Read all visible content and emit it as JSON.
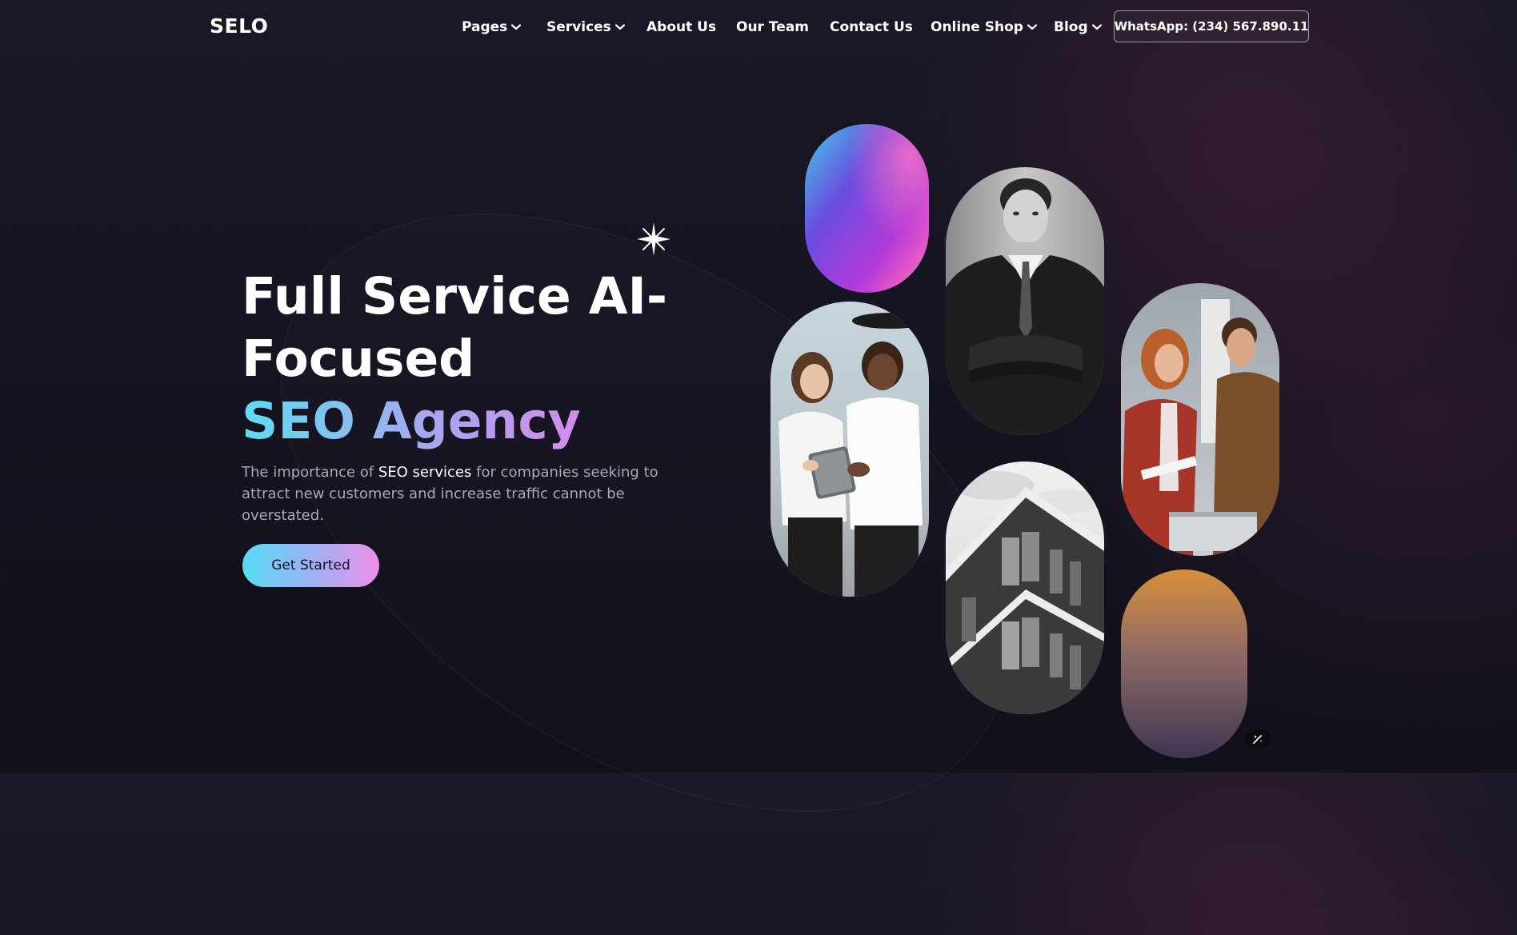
{
  "nav": {
    "logo": "SELO",
    "items": [
      {
        "label": "Pages",
        "dropdown": true
      },
      {
        "label": "Services",
        "dropdown": true
      },
      {
        "label": "About Us",
        "dropdown": false
      },
      {
        "label": "Our Team",
        "dropdown": false
      },
      {
        "label": "Contact Us",
        "dropdown": false
      },
      {
        "label": "Online Shop",
        "dropdown": true
      },
      {
        "label": "Blog",
        "dropdown": true
      }
    ],
    "whatsapp_label": "WhatsApp: (234) 567.890.11"
  },
  "hero": {
    "title_line1": "Full Service AI-",
    "title_line2": "Focused",
    "title_highlight": "SEO Agency",
    "desc_prefix": "The importance of ",
    "desc_strong": "SEO services",
    "desc_suffix": " for companies seeking to attract new customers and increase traffic cannot be overstated.",
    "cta_label": "Get Started"
  },
  "colors": {
    "background": "#15141f",
    "accent_start": "#57dcf5",
    "accent_mid": "#9bb2f3",
    "accent_end": "#ef8fe9"
  },
  "gallery": [
    {
      "name": "gradient-pill-purple"
    },
    {
      "name": "photo-two-women-tablet"
    },
    {
      "name": "photo-man-in-suit"
    },
    {
      "name": "photo-building"
    },
    {
      "name": "photo-team-laptop"
    },
    {
      "name": "gradient-pill-amber"
    }
  ],
  "icons": {
    "star": "sparkle-star-icon",
    "chevron": "chevron-down-icon",
    "fab": "magic-wand-icon"
  }
}
